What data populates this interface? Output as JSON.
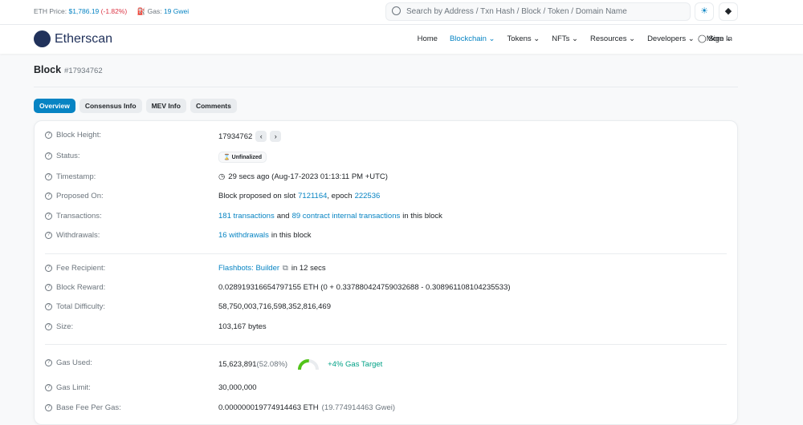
{
  "topbar": {
    "eth_price_label": "ETH Price:",
    "eth_price": "$1,786.19",
    "eth_change": "(-1.82%)",
    "gas_label": "Gas:",
    "gas_value": "19 Gwei",
    "search_placeholder": "Search by Address / Txn Hash / Block / Token / Domain Name"
  },
  "nav": {
    "logo": "Etherscan",
    "items": [
      "Home",
      "Blockchain",
      "Tokens",
      "NFTs",
      "Resources",
      "Developers",
      "More"
    ],
    "sign_in": "Sign In"
  },
  "page": {
    "title": "Block",
    "block_number": "#17934762"
  },
  "tabs": [
    "Overview",
    "Consensus Info",
    "MEV Info",
    "Comments"
  ],
  "fields": {
    "block_height": {
      "label": "Block Height:",
      "value": "17934762"
    },
    "status": {
      "label": "Status:",
      "value": "Unfinalized"
    },
    "timestamp": {
      "label": "Timestamp:",
      "value": "29 secs ago (Aug-17-2023 01:13:11 PM +UTC)"
    },
    "proposed": {
      "label": "Proposed On:",
      "pre": "Block proposed on slot",
      "slot": "7121164",
      "mid": ", epoch",
      "epoch": "222536"
    },
    "transactions": {
      "label": "Transactions:",
      "txns": "181 transactions",
      "mid": "and",
      "internal": "89 contract internal transactions",
      "post": "in this block"
    },
    "withdrawals": {
      "label": "Withdrawals:",
      "link": "16 withdrawals",
      "post": "in this block"
    },
    "fee_recipient": {
      "label": "Fee Recipient:",
      "link": "Flashbots: Builder",
      "post": "in 12 secs"
    },
    "block_reward": {
      "label": "Block Reward:",
      "value": "0.028919316654797155 ETH (0 + 0.337880424759032688 - 0.308961108104235533)"
    },
    "total_difficulty": {
      "label": "Total Difficulty:",
      "value": "58,750,003,716,598,352,816,469"
    },
    "size": {
      "label": "Size:",
      "value": "103,167 bytes"
    },
    "gas_used": {
      "label": "Gas Used:",
      "value": "15,623,891",
      "percent": "(52.08%)",
      "percent_num": 52.08,
      "target": "+4% Gas Target"
    },
    "gas_limit": {
      "label": "Gas Limit:",
      "value": "30,000,000"
    },
    "base_fee": {
      "label": "Base Fee Per Gas:",
      "value": "0.000000019774914463 ETH",
      "gwei": "(19.774914463 Gwei)"
    }
  },
  "colors": {
    "accent": "#0784c3",
    "negative": "#dc3545",
    "positive": "#00a186",
    "gauge": "#52c41a"
  }
}
